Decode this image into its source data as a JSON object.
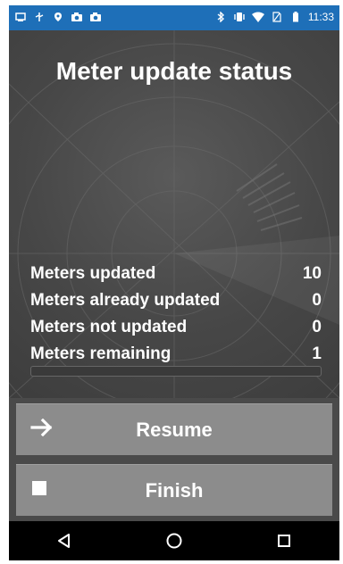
{
  "status_bar": {
    "time": "11:33",
    "left_icons": [
      "notification-icon",
      "usb-icon",
      "location-icon",
      "camera-icon",
      "camera-icon"
    ],
    "right_icons": [
      "bluetooth-icon",
      "vibrate-icon",
      "wifi-icon",
      "no-sim-icon",
      "battery-icon"
    ]
  },
  "title": "Meter update status",
  "stats": [
    {
      "label": "Meters updated",
      "value": "10"
    },
    {
      "label": "Meters already updated",
      "value": "0"
    },
    {
      "label": "Meters not updated",
      "value": "0"
    },
    {
      "label": "Meters remaining",
      "value": "1"
    }
  ],
  "progress": {
    "percent": 0
  },
  "buttons": {
    "resume": {
      "label": "Resume",
      "icon": "arrow-right-icon"
    },
    "finish": {
      "label": "Finish",
      "icon": "stop-icon"
    }
  },
  "navbar": {
    "icons": [
      "back-icon",
      "home-icon",
      "recents-icon"
    ]
  },
  "colors": {
    "status_bar": "#1e6fb8",
    "background": "#474747",
    "button": "#8c8c8c",
    "text": "#ffffff"
  }
}
